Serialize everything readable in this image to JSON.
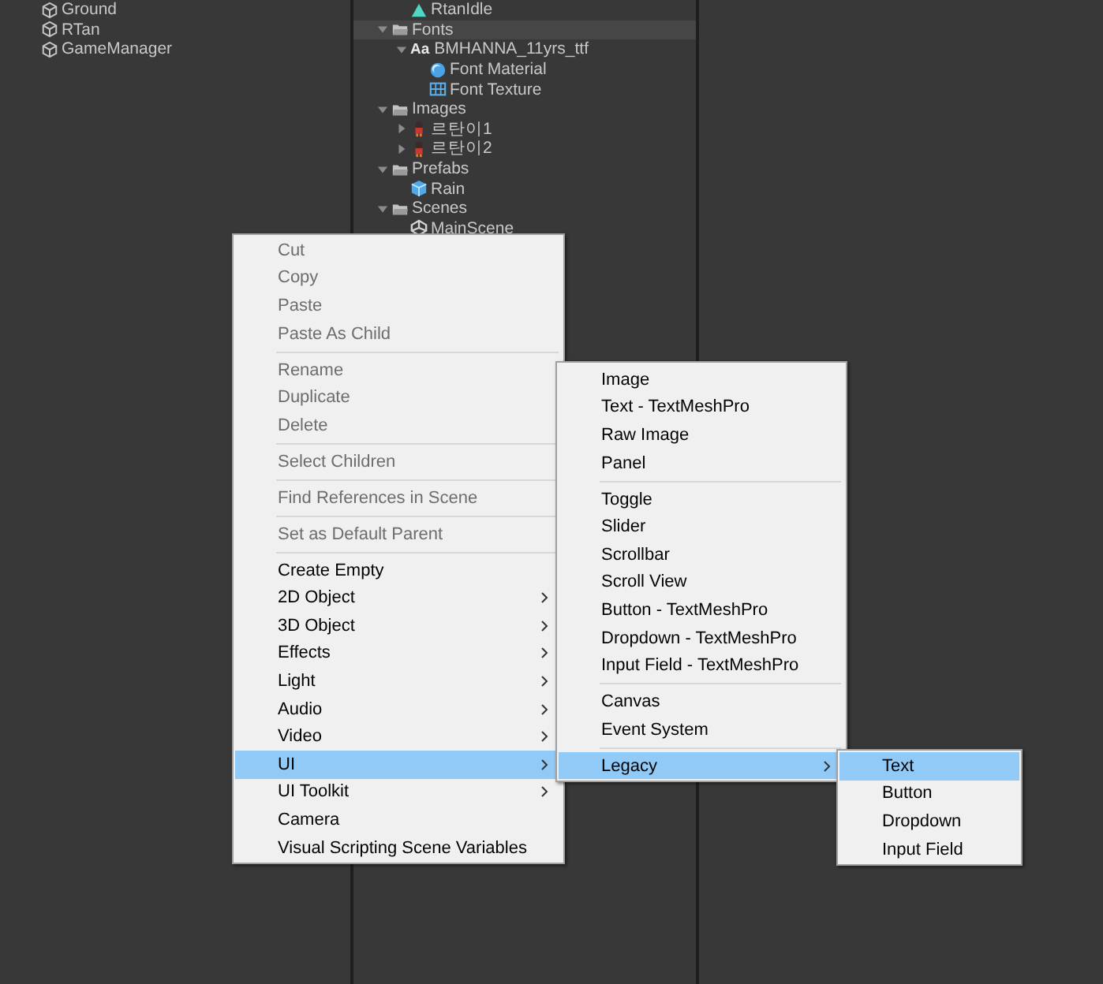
{
  "hierarchy": {
    "items": [
      {
        "label": "Ground",
        "kind": "gameobject"
      },
      {
        "label": "RTan",
        "kind": "gameobject"
      },
      {
        "label": "GameManager",
        "kind": "gameobject"
      }
    ]
  },
  "project": {
    "items": [
      {
        "children": [
          {
            "label": "RtanIdle",
            "kind": "animation",
            "selected": false
          }
        ]
      },
      {
        "label": "Fonts",
        "kind": "folder",
        "expanded": true,
        "selected": true,
        "children": [
          {
            "label": "BMHANNA_11yrs_ttf",
            "kind": "font",
            "icon_text": "Aa",
            "expanded": true,
            "selected": false,
            "children": [
              {
                "label": "Font Material",
                "kind": "material",
                "selected": false
              },
              {
                "label": "Font Texture",
                "kind": "texture",
                "selected": false
              }
            ]
          }
        ]
      },
      {
        "label": "Images",
        "kind": "folder",
        "expanded": true,
        "selected": false,
        "children": [
          {
            "label": "르탄이1",
            "kind": "sprite",
            "expanded": false,
            "selected": false
          },
          {
            "label": "르탄이2",
            "kind": "sprite",
            "expanded": false,
            "selected": false
          }
        ]
      },
      {
        "label": "Prefabs",
        "kind": "folder",
        "expanded": true,
        "selected": false,
        "children": [
          {
            "label": "Rain",
            "kind": "prefab",
            "selected": false
          }
        ]
      },
      {
        "label": "Scenes",
        "kind": "folder",
        "expanded": true,
        "selected": false,
        "children": [
          {
            "label": "MainScene",
            "kind": "scene",
            "selected": false
          }
        ]
      }
    ]
  },
  "context_menu": {
    "groups": [
      [
        {
          "label": "Cut",
          "disabled": true,
          "submenu": false,
          "selected": false
        },
        {
          "label": "Copy",
          "disabled": true,
          "submenu": false,
          "selected": false
        },
        {
          "label": "Paste",
          "disabled": true,
          "submenu": false,
          "selected": false
        },
        {
          "label": "Paste As Child",
          "disabled": true,
          "submenu": false,
          "selected": false
        }
      ],
      [
        {
          "label": "Rename",
          "disabled": true,
          "submenu": false,
          "selected": false
        },
        {
          "label": "Duplicate",
          "disabled": true,
          "submenu": false,
          "selected": false
        },
        {
          "label": "Delete",
          "disabled": true,
          "submenu": false,
          "selected": false
        }
      ],
      [
        {
          "label": "Select Children",
          "disabled": true,
          "submenu": false,
          "selected": false
        }
      ],
      [
        {
          "label": "Find References in Scene",
          "disabled": true,
          "submenu": false,
          "selected": false
        }
      ],
      [
        {
          "label": "Set as Default Parent",
          "disabled": true,
          "submenu": false,
          "selected": false
        }
      ],
      [
        {
          "label": "Create Empty",
          "disabled": false,
          "submenu": false,
          "selected": false
        },
        {
          "label": "2D Object",
          "disabled": false,
          "submenu": true,
          "selected": false
        },
        {
          "label": "3D Object",
          "disabled": false,
          "submenu": true,
          "selected": false
        },
        {
          "label": "Effects",
          "disabled": false,
          "submenu": true,
          "selected": false
        },
        {
          "label": "Light",
          "disabled": false,
          "submenu": true,
          "selected": false
        },
        {
          "label": "Audio",
          "disabled": false,
          "submenu": true,
          "selected": false
        },
        {
          "label": "Video",
          "disabled": false,
          "submenu": true,
          "selected": false
        },
        {
          "label": "UI",
          "disabled": false,
          "submenu": true,
          "selected": true
        },
        {
          "label": "UI Toolkit",
          "disabled": false,
          "submenu": true,
          "selected": false
        },
        {
          "label": "Camera",
          "disabled": false,
          "submenu": false,
          "selected": false
        },
        {
          "label": "Visual Scripting Scene Variables",
          "disabled": false,
          "submenu": false,
          "selected": false
        }
      ]
    ]
  },
  "ui_submenu": {
    "groups": [
      [
        {
          "label": "Image",
          "submenu": false,
          "selected": false
        },
        {
          "label": "Text - TextMeshPro",
          "submenu": false,
          "selected": false
        },
        {
          "label": "Raw Image",
          "submenu": false,
          "selected": false
        },
        {
          "label": "Panel",
          "submenu": false,
          "selected": false
        }
      ],
      [
        {
          "label": "Toggle",
          "submenu": false,
          "selected": false
        },
        {
          "label": "Slider",
          "submenu": false,
          "selected": false
        },
        {
          "label": "Scrollbar",
          "submenu": false,
          "selected": false
        },
        {
          "label": "Scroll View",
          "submenu": false,
          "selected": false
        },
        {
          "label": "Button - TextMeshPro",
          "submenu": false,
          "selected": false
        },
        {
          "label": "Dropdown - TextMeshPro",
          "submenu": false,
          "selected": false
        },
        {
          "label": "Input Field - TextMeshPro",
          "submenu": false,
          "selected": false
        }
      ],
      [
        {
          "label": "Canvas",
          "submenu": false,
          "selected": false
        },
        {
          "label": "Event System",
          "submenu": false,
          "selected": false
        }
      ],
      [
        {
          "label": "Legacy",
          "submenu": true,
          "selected": true
        }
      ]
    ]
  },
  "legacy_submenu": {
    "groups": [
      [
        {
          "label": "Text",
          "submenu": false,
          "selected": true
        },
        {
          "label": "Button",
          "submenu": false,
          "selected": false
        },
        {
          "label": "Dropdown",
          "submenu": false,
          "selected": false
        },
        {
          "label": "Input Field",
          "submenu": false,
          "selected": false
        }
      ]
    ]
  }
}
